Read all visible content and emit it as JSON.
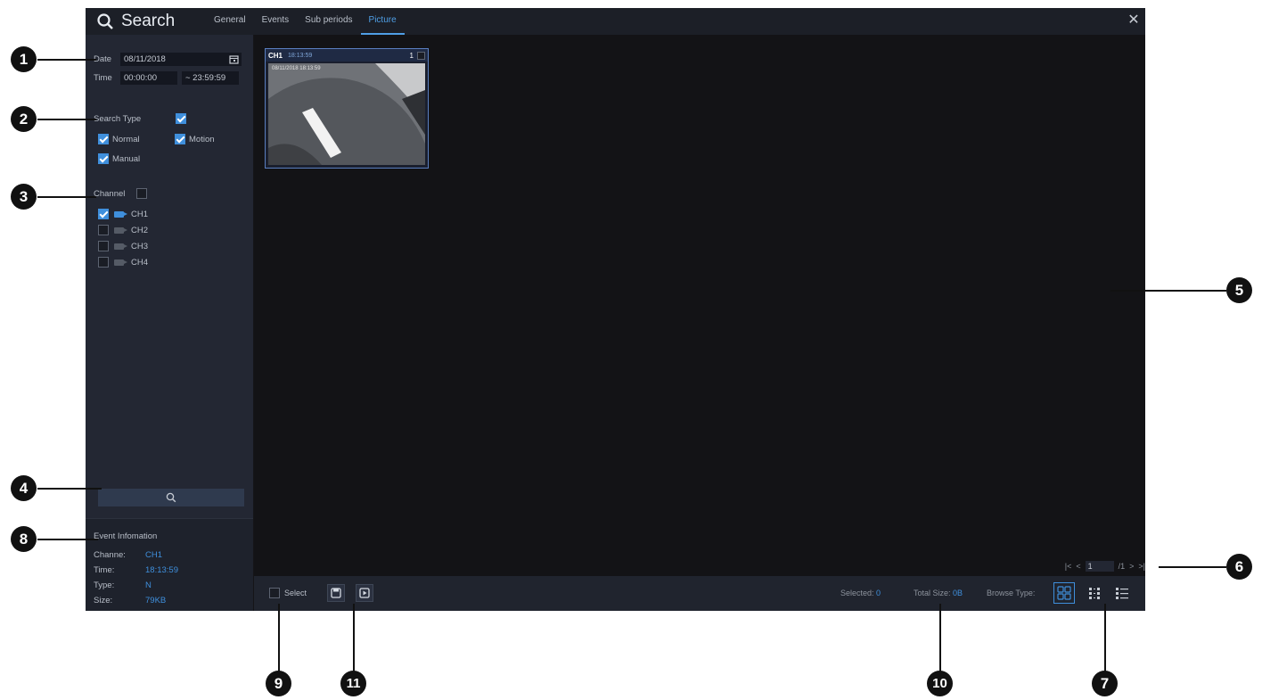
{
  "app": {
    "title": "Search"
  },
  "tabs": [
    {
      "label": "General",
      "active": false
    },
    {
      "label": "Events",
      "active": false
    },
    {
      "label": "Sub periods",
      "active": false
    },
    {
      "label": "Picture",
      "active": true
    }
  ],
  "sidebar": {
    "date_label": "Date",
    "date_value": "08/11/2018",
    "time_label": "Time",
    "time_start": "00:00:00",
    "time_end": "~ 23:59:59",
    "search_type_label": "Search Type",
    "types": [
      {
        "label": "Normal",
        "checked": true
      },
      {
        "label": "Motion",
        "checked": true
      },
      {
        "label": "Manual",
        "checked": true
      }
    ],
    "channel_label": "Channel",
    "channels": [
      {
        "label": "CH1",
        "checked": true
      },
      {
        "label": "CH2",
        "checked": false
      },
      {
        "label": "CH3",
        "checked": false
      },
      {
        "label": "CH4",
        "checked": false
      }
    ]
  },
  "event_info": {
    "heading": "Event Infomation",
    "channel_label": "Channe:",
    "channel_value": "CH1",
    "time_label": "Time:",
    "time_value": "18:13:59",
    "type_label": "Type:",
    "type_value": "N",
    "size_label": "Size:",
    "size_value": "79KB"
  },
  "thumbnail": {
    "channel": "CH1",
    "time": "18:13:59",
    "index": "1",
    "overlay_text": "08/11/2018 18:13:59"
  },
  "pager": {
    "current": "1",
    "total": "/1"
  },
  "bottom": {
    "select_label": "Select",
    "selected_label": "Selected:",
    "selected_value": "0",
    "total_size_label": "Total Size:",
    "total_size_value": "0B",
    "browse_type_label": "Browse Type:"
  },
  "callouts": [
    "1",
    "2",
    "3",
    "4",
    "5",
    "6",
    "7",
    "8",
    "9",
    "10",
    "11"
  ],
  "colors": {
    "accent": "#3f8fdc",
    "panel": "#232733",
    "background": "#151518"
  }
}
